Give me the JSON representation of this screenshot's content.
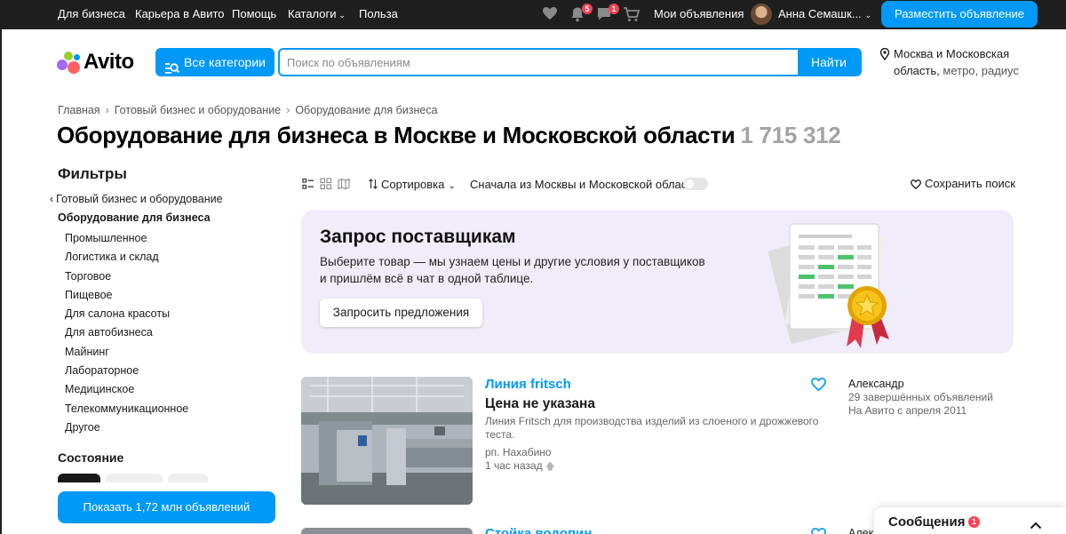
{
  "topnav": {
    "links": [
      "Для бизнеса",
      "Карьера в Авито",
      "Помощь",
      "Каталоги",
      "Польза"
    ],
    "notifications_badge": "5",
    "messages_badge": "1",
    "my_ads": "Мои объявления",
    "user_name": "Анна Семашк...",
    "place_ad": "Разместить объявление"
  },
  "header": {
    "logo": "Avito",
    "categories_button": "Все категории",
    "search_placeholder": "Поиск по объявлениям",
    "search_button": "Найти",
    "location": "Москва и Московская область,",
    "location_extra": "метро, радиус"
  },
  "breadcrumbs": [
    "Главная",
    "Готовый бизнес и оборудование",
    "Оборудование для бизнеса"
  ],
  "page": {
    "title": "Оборудование для бизнеса в Москве и Московской области",
    "count": "1 715 312"
  },
  "filters": {
    "heading": "Фильтры",
    "parent": "Готовый бизнес и оборудование",
    "current": "Оборудование для бизнеса",
    "subcategories": [
      "Промышленное",
      "Логистика и склад",
      "Торговое",
      "Пищевое",
      "Для салона красоты",
      "Для автобизнеса",
      "Майнинг",
      "Лабораторное",
      "Медицинское",
      "Телекоммуникационное",
      "Другое"
    ],
    "state_heading": "Состояние",
    "show_button": "Показать 1,72 млн объявлений"
  },
  "toolbar": {
    "sort": "Сортировка",
    "first_from": "Сначала из Москвы и Московской области",
    "save_search": "Сохранить поиск"
  },
  "promo": {
    "title": "Запрос поставщикам",
    "text": "Выберите товар — мы узнаем цены и другие условия у поставщиков и пришлём всё в чат в одной таблице.",
    "button": "Запросить предложения"
  },
  "listings": [
    {
      "title": "Линия fritsch",
      "price": "Цена не указана",
      "description": "Линия Fritsch для производства изделий из слоеного и дрожжевого теста.",
      "location": "рп. Нахабино",
      "time": "1 час назад",
      "seller": "Александр",
      "seller_stats": [
        "29 завершённых объявлений",
        "На Авито с апреля 2011"
      ]
    },
    {
      "title": "Стойка водопин",
      "seller": "Алекс"
    }
  ],
  "messenger": {
    "label": "Сообщения",
    "badge": "1"
  },
  "colors": {
    "accent": "#0099f7",
    "topbar": "#1f1f1f",
    "badge": "#ff4053",
    "promo_bg": "#f1ecfa"
  }
}
